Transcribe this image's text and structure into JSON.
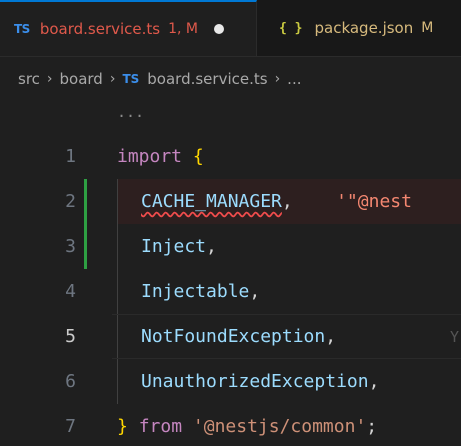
{
  "tabs": [
    {
      "icon": "TS",
      "name": "board.service.ts",
      "status": "1, M",
      "active": true,
      "dirty": true
    },
    {
      "icon": "{ }",
      "name": "package.json",
      "status": "M",
      "active": false
    }
  ],
  "breadcrumb": {
    "parts": [
      "src",
      "board"
    ],
    "file_icon": "TS",
    "file": "board.service.ts",
    "trailing": "..."
  },
  "sticky_ellipsis": "...",
  "code": {
    "lines": [
      {
        "number": "1",
        "tokens": [
          "import",
          "{"
        ]
      },
      {
        "number": "2",
        "tokens": [
          "CACHE_MANAGER",
          ",",
          "'\"@nest"
        ]
      },
      {
        "number": "3",
        "tokens": [
          "Inject",
          ","
        ]
      },
      {
        "number": "4",
        "tokens": [
          "Injectable",
          ","
        ]
      },
      {
        "number": "5",
        "tokens": [
          "NotFoundException",
          ",",
          "Y"
        ]
      },
      {
        "number": "6",
        "tokens": [
          "UnauthorizedException",
          ","
        ]
      },
      {
        "number": "7",
        "tokens": [
          "}",
          "from",
          "'@nestjs/common'",
          ";"
        ]
      }
    ]
  },
  "colors": {
    "keyword": "#c586c0",
    "identifier": "#9cdcfe",
    "string": "#ce9178",
    "brace": "#ffd700",
    "error": "#f14c4c",
    "git_added": "#2ea043",
    "ts_icon": "#3b8eea"
  }
}
